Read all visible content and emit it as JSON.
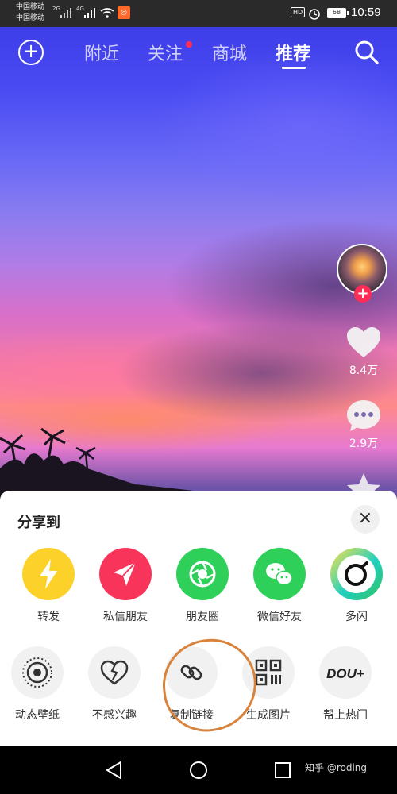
{
  "status_bar": {
    "carrier_1": "中国移动",
    "carrier_2": "中国移动",
    "signal_1": "2G",
    "signal_2": "4G",
    "hd": "HD",
    "battery": "68",
    "time": "10:59"
  },
  "top_nav": {
    "tabs": [
      {
        "label": "附近"
      },
      {
        "label": "关注"
      },
      {
        "label": "商城"
      },
      {
        "label": "推荐"
      }
    ],
    "active_tab": "推荐"
  },
  "side_actions": {
    "like_count": "8.4万",
    "comment_count": "2.9万"
  },
  "share_sheet": {
    "title": "分享到",
    "close_label": "×",
    "row1": [
      {
        "label": "转发",
        "icon": "lightning-icon",
        "color": "#fcd22a"
      },
      {
        "label": "私信朋友",
        "icon": "paper-plane-icon",
        "color": "#f9345a"
      },
      {
        "label": "朋友圈",
        "icon": "aperture-icon",
        "color": "#2ed05a"
      },
      {
        "label": "微信好友",
        "icon": "wechat-icon",
        "color": "#2ed05a"
      },
      {
        "label": "多闪",
        "icon": "duoshan-icon",
        "color": "#20d0c0"
      }
    ],
    "row2": [
      {
        "label": "动态壁纸",
        "icon": "live-wallpaper-icon"
      },
      {
        "label": "不感兴趣",
        "icon": "broken-heart-icon"
      },
      {
        "label": "复制链接",
        "icon": "link-icon"
      },
      {
        "label": "生成图片",
        "icon": "qr-code-icon"
      },
      {
        "label": "帮上热门",
        "icon": "dou-plus-icon",
        "badge": "DOU+"
      }
    ]
  },
  "watermark": "知乎 @roding"
}
